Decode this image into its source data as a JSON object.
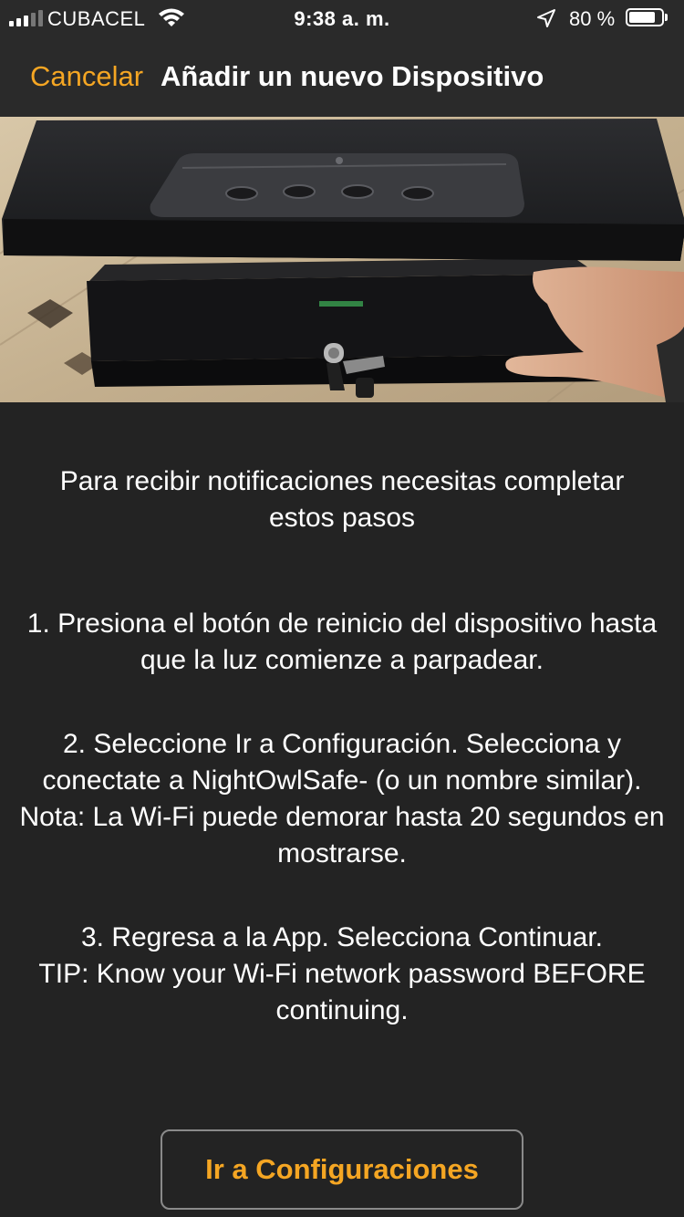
{
  "status_bar": {
    "carrier": "CUBACEL",
    "time": "9:38 a. m.",
    "battery_percent": "80 %",
    "battery_level": 0.8,
    "icons": [
      "signal-icon",
      "wifi-icon",
      "location-arrow-icon",
      "battery-icon"
    ]
  },
  "nav": {
    "cancel_label": "Cancelar",
    "title": "Añadir un nuevo Dispositivo"
  },
  "hero": {
    "image_subject": "black gun safe with keypad and keys, hand lifting lid"
  },
  "content": {
    "intro": "Para recibir notificaciones necesitas completar estos pasos",
    "steps": [
      {
        "lines": [
          "1. Presiona el botón de reinicio del dispositivo hasta que la luz comienze a parpadear."
        ]
      },
      {
        "lines": [
          "2. Seleccione Ir a Configuración. Selecciona y conectate a NightOwlSafe- (o un nombre similar).",
          "Nota: La Wi-Fi puede demorar hasta 20 segundos en mostrarse."
        ]
      },
      {
        "lines": [
          "3. Regresa a la App. Selecciona Continuar.",
          "TIP: Know your Wi-Fi network password BEFORE continuing."
        ]
      }
    ]
  },
  "actions": {
    "config_button_label": "Ir a Configuraciones"
  },
  "colors": {
    "accent": "#f5a623",
    "background": "#232323",
    "bar_background": "#2a2a2a",
    "text": "#ffffff"
  }
}
